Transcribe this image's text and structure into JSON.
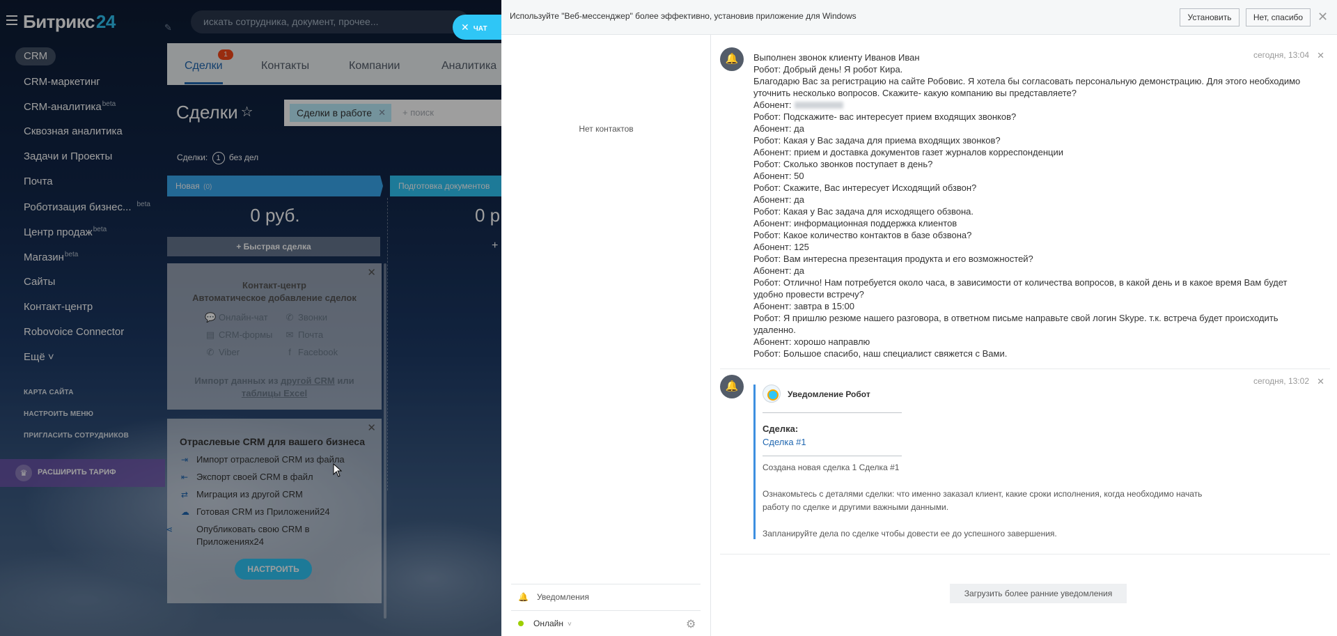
{
  "app": {
    "logo_name": "Битрикс",
    "logo_num": "24",
    "search_placeholder": "искать сотрудника, документ, прочее...",
    "chat_label": "ЧАТ"
  },
  "sidebar": {
    "crm_chip": "CRM",
    "items": [
      {
        "label": "CRM-маркетинг",
        "sup": ""
      },
      {
        "label": "CRM-аналитика",
        "sup": "beta"
      },
      {
        "label": "Сквозная аналитика",
        "sup": ""
      },
      {
        "label": "Задачи и Проекты",
        "sup": ""
      },
      {
        "label": "Почта",
        "sup": ""
      },
      {
        "label": "Роботизация бизнес...",
        "sup": "beta"
      },
      {
        "label": "Центр продаж",
        "sup": "beta"
      },
      {
        "label": "Магазин",
        "sup": "beta"
      },
      {
        "label": "Сайты",
        "sup": ""
      },
      {
        "label": "Контакт-центр",
        "sup": ""
      },
      {
        "label": "Robovoice Connector",
        "sup": ""
      },
      {
        "label": "Ещё ˅",
        "sup": ""
      }
    ],
    "small_links": [
      "КАРТА САЙТА",
      "НАСТРОИТЬ МЕНЮ",
      "ПРИГЛАСИТЬ СОТРУДНИКОВ"
    ],
    "upgrade_label": "РАСШИРИТЬ ТАРИФ"
  },
  "crm": {
    "tabs": [
      "Сделки",
      "Контакты",
      "Компании",
      "Аналитика"
    ],
    "tab_badge": "1",
    "title": "Сделки",
    "filter_chip": "Сделки в работе",
    "filter_placeholder": "+ поиск",
    "counter_prefix": "Сделки:",
    "counter_value": "1",
    "counter_suffix": "без дел",
    "stage_new": "Новая",
    "stage_new_count": "(0)",
    "stage_prep": "Подготовка документов",
    "stage_sum": "0 руб.",
    "stage_sum2": "0 р",
    "quick_deal": "+ Быстрая сделка",
    "contact_center": {
      "title_1": "Контакт-центр",
      "title_2": "Автоматическое добавление сделок",
      "channels": [
        "Онлайн-чат",
        "Звонки",
        "CRM-формы",
        "Почта",
        "Viber",
        "Facebook"
      ],
      "import_1": "Импорт данных из",
      "import_link1": "другой CRM",
      "import_2": "или",
      "import_link2": "таблицы Excel"
    },
    "industry": {
      "title": "Отраслевые CRM для вашего бизнеса",
      "items": [
        "Импорт отраслевой CRM из файла",
        "Экспорт своей CRM в файл",
        "Миграция из другой CRM",
        "Готовая CRM из Приложений24",
        "Опубликовать свою CRM в Приложениях24"
      ],
      "button": "НАСТРОИТЬ"
    }
  },
  "messenger": {
    "banner": "Используйте \"Веб-мессенджер\" более эффективно, установив приложение для Windows",
    "install": "Установить",
    "no_thanks": "Нет, спасибо",
    "no_contacts": "Нет контактов",
    "notifications_label": "Уведомления",
    "status": "Онлайн",
    "load_more": "Загрузить более ранние уведомления",
    "call": {
      "time": "сегодня, 13:04",
      "lines": [
        "Выполнен звонок клиенту Иванов Иван",
        "Робот: Добрый день! Я робот Кира.",
        "Благодарю Вас за регистрацию на сайте Робовис.   Я хотела бы согласовать персональную демонстрацию. Для этого необходимо уточнить несколько вопросов.   Скажите- какую компанию вы представляете?",
        "Абонент:",
        "Робот: Подскажите- вас интересует прием входящих звонков?",
        "Абонент: да",
        "Робот: Какая у Вас задача для приема входящих звонков?",
        "Абонент: прием и доставка документов газет журналов корреспонденции",
        "Робот: Сколько звонков поступает в день?",
        "Абонент: 50",
        "Робот: Скажите, Вас интересует Исходящий обзвон?",
        "Абонент: да",
        "Робот: Какая у Вас задача для исходящего обзвона.",
        "Абонент: информационная поддержка клиентов",
        "Робот: Какое количество контактов в базе обзвона?",
        "Абонент: 125",
        "Робот: Вам интересна презентация продукта и его возможностей?",
        "Абонент: да",
        "Робот: Отлично! Нам потребуется около часа, в зависимости от количества вопросов, в какой день и в какое время Вам будет удобно провести встречу?",
        "Абонент: завтра в 15:00",
        "Робот: Я пришлю резюме нашего разговора, в ответном письме направьте свой логин Skype. т.к. встреча будет происходить удаленно.",
        "Абонент: хорошо направлю",
        "Робот: Большое спасибо, наш специалист свяжется с Вами."
      ]
    },
    "robot": {
      "time": "сегодня, 13:02",
      "name": "Уведомление Робот",
      "deal_label": "Сделка:",
      "deal_link": "Сделка #1",
      "created": "Создана новая сделка 1 Сделка #1",
      "details_1": "Ознакомьтесь с деталями сделки: что именно заказал клиент, какие сроки исполнения, когда необходимо начать",
      "details_2": "работу по сделке и другими важными данными.",
      "plan": "Запланируйте дела по сделке чтобы довести ее до успешного завершения."
    }
  }
}
